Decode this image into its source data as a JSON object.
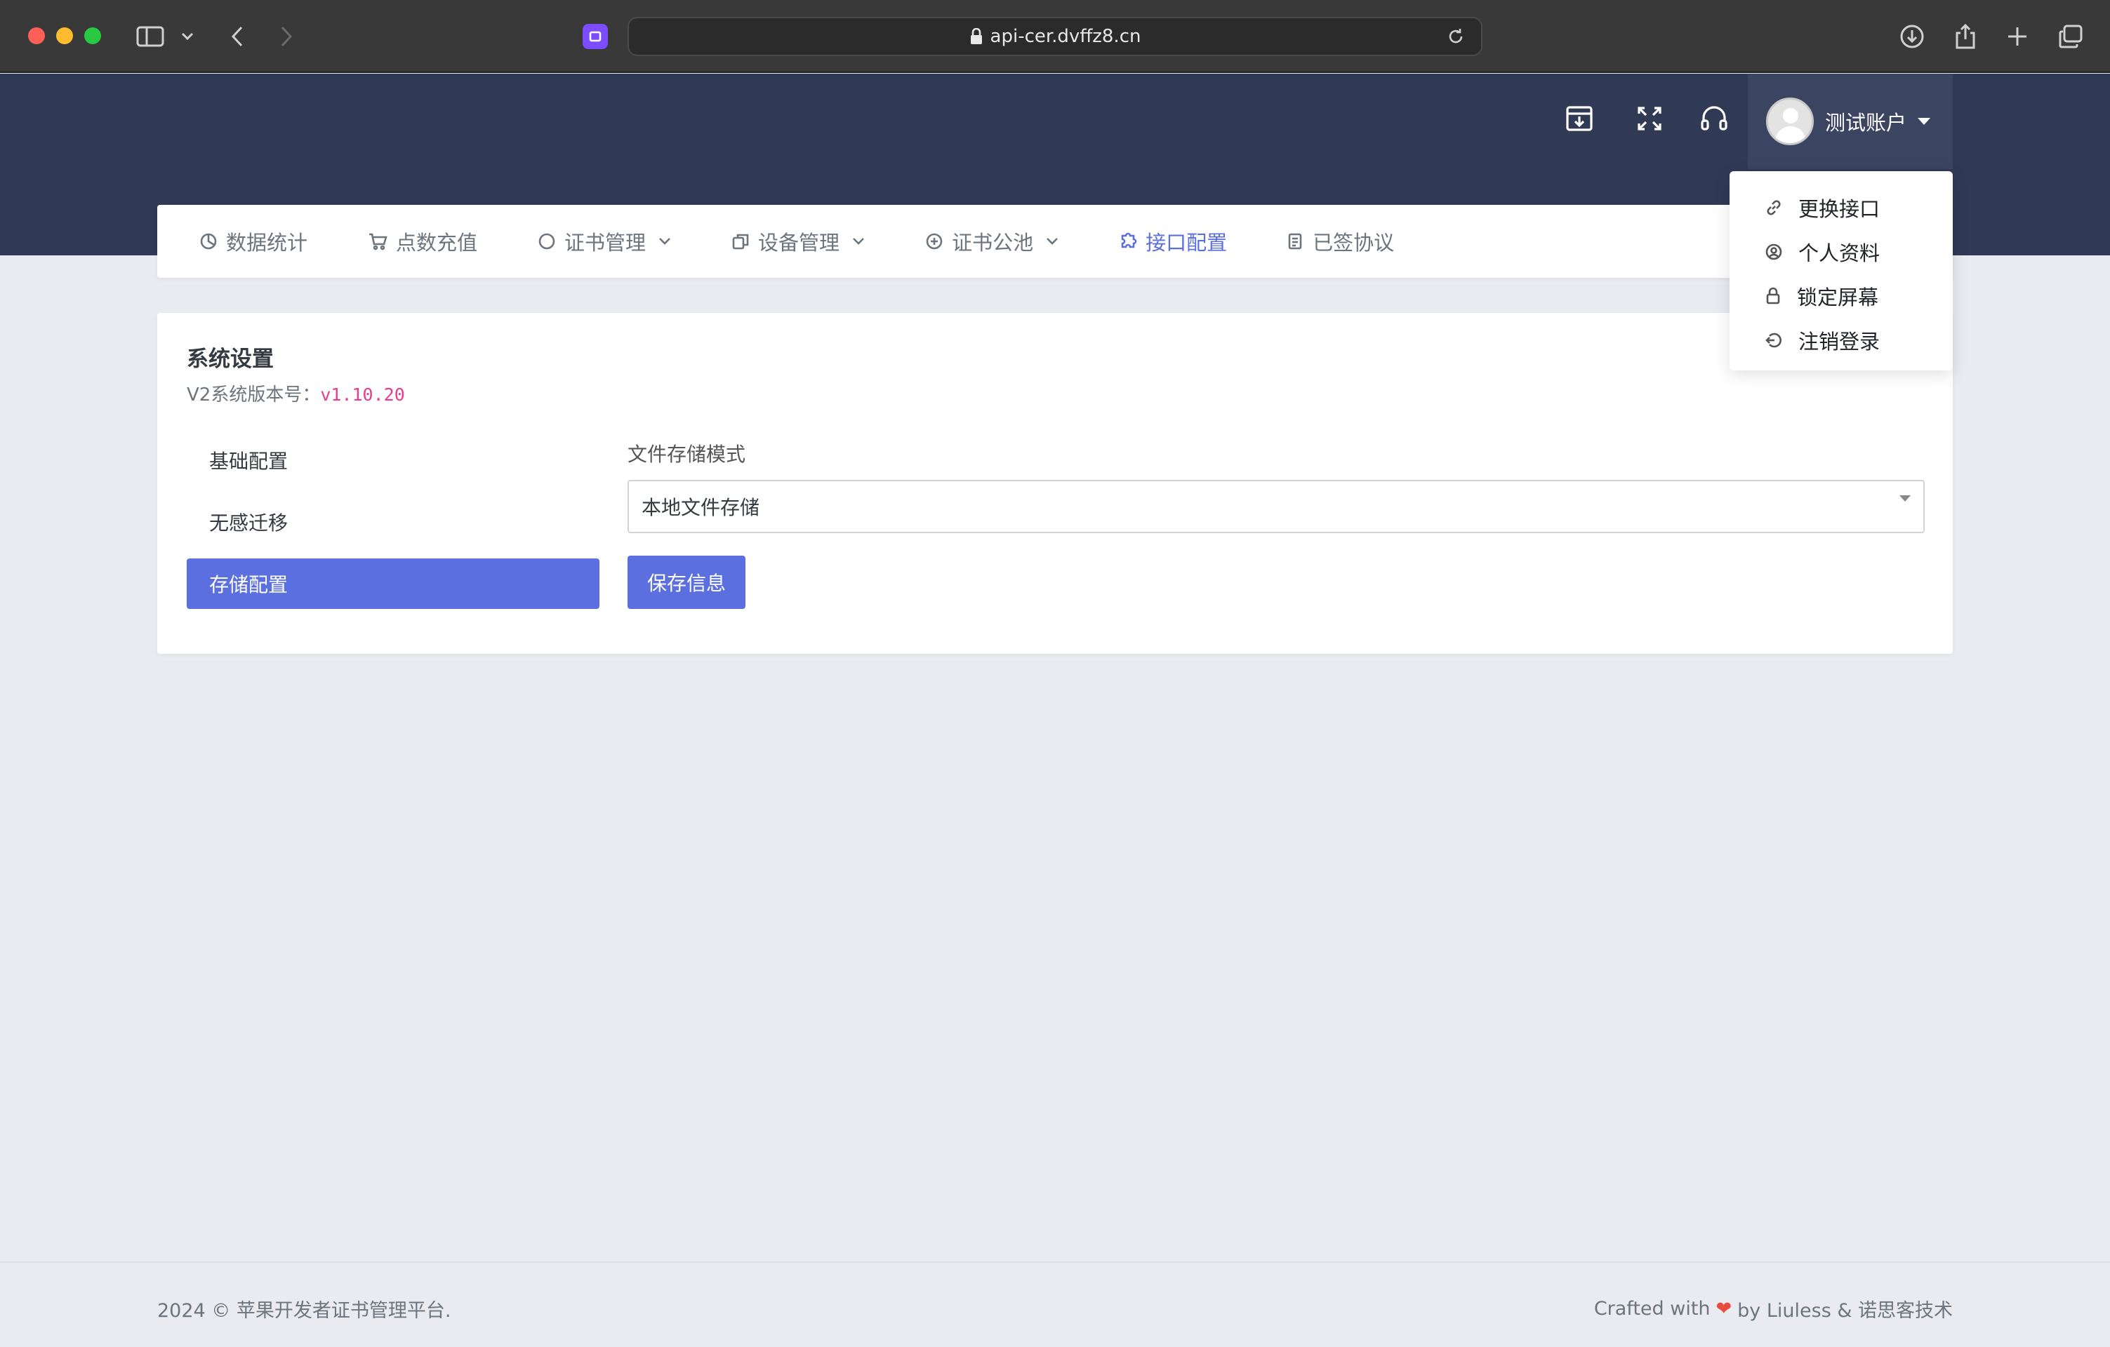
{
  "browser": {
    "url": "api-cer.dvffz8.cn"
  },
  "header": {
    "user_name": "测试账户"
  },
  "nav": {
    "items": [
      {
        "label": "数据统计",
        "icon": "pie-chart-icon",
        "dropdown": false,
        "active": false
      },
      {
        "label": "点数充值",
        "icon": "cart-icon",
        "dropdown": false,
        "active": false
      },
      {
        "label": "证书管理",
        "icon": "circle-icon",
        "dropdown": true,
        "active": false
      },
      {
        "label": "设备管理",
        "icon": "copy-icon",
        "dropdown": true,
        "active": false
      },
      {
        "label": "证书公池",
        "icon": "plus-circle-icon",
        "dropdown": true,
        "active": false
      },
      {
        "label": "接口配置",
        "icon": "puzzle-icon",
        "dropdown": false,
        "active": true
      },
      {
        "label": "已签协议",
        "icon": "document-icon",
        "dropdown": false,
        "active": false
      }
    ]
  },
  "user_menu": {
    "items": [
      {
        "label": "更换接口",
        "icon": "link-icon"
      },
      {
        "label": "个人资料",
        "icon": "user-circle-icon"
      },
      {
        "label": "锁定屏幕",
        "icon": "lock-icon"
      },
      {
        "label": "注销登录",
        "icon": "logout-icon"
      }
    ]
  },
  "settings": {
    "title": "系统设置",
    "version_label": "V2系统版本号：",
    "version": "v1.10.20",
    "side_menu": [
      {
        "label": "基础配置",
        "active": false
      },
      {
        "label": "无感迁移",
        "active": false
      },
      {
        "label": "存储配置",
        "active": true
      }
    ],
    "storage_mode_label": "文件存储模式",
    "storage_mode_value": "本地文件存储",
    "save_label": "保存信息"
  },
  "footer": {
    "left": "2024 © 苹果开发者证书管理平台.",
    "right_prefix": "Crafted with",
    "right_suffix": "by Liuless & 诺思客技术"
  },
  "colors": {
    "header_bg": "#313a55",
    "accent": "#5b6fde",
    "version_text": "#e83e8c",
    "heart": "#e74c3c"
  }
}
